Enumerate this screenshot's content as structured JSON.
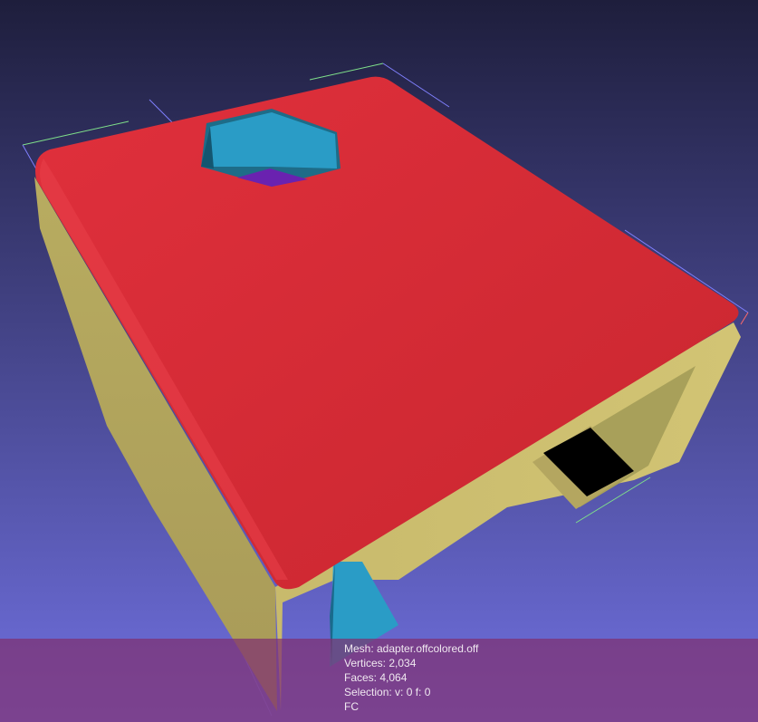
{
  "viewer": {
    "background_top": "#1e1e3c",
    "background_bottom": "#7070e0",
    "mesh_colors": {
      "top": "#d42a34",
      "side": "#c4b86a",
      "hole": "#2a9cc6",
      "inner": "#6a22b0",
      "opening": "#000000"
    }
  },
  "info": {
    "mesh": "Mesh: adapter.offcolored.off",
    "vertices": "Vertices: 2,034",
    "faces": "Faces: 4,064",
    "selection": "Selection: v: 0 f: 0",
    "mode": "FC"
  }
}
